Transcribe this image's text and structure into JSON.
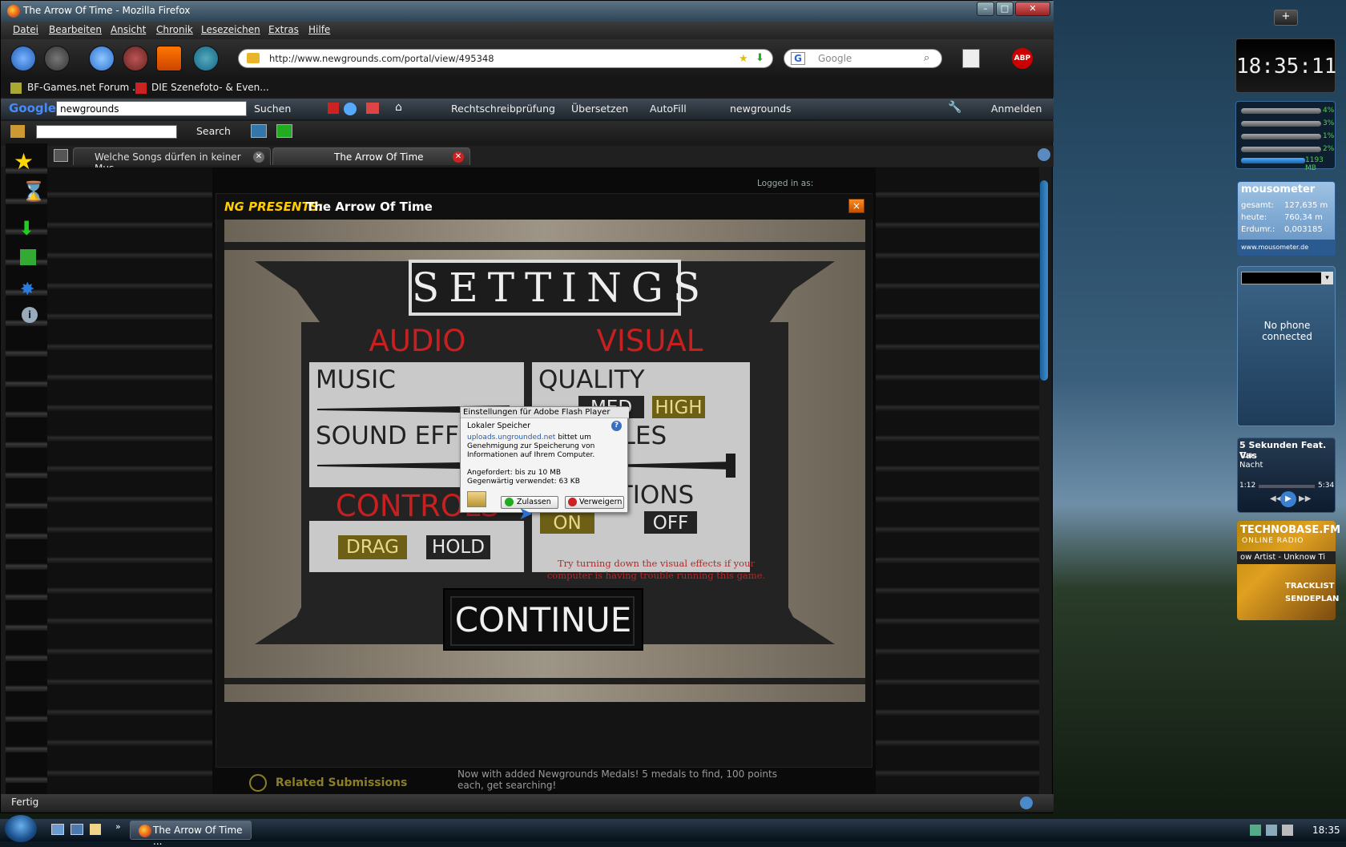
{
  "window": {
    "title": "The Arrow Of Time - Mozilla Firefox"
  },
  "menu": [
    "Datei",
    "Bearbeiten",
    "Ansicht",
    "Chronik",
    "Lesezeichen",
    "Extras",
    "Hilfe"
  ],
  "nav": {
    "url": "http://www.newgrounds.com/portal/view/495348",
    "search_placeholder": "Google"
  },
  "bookmarks": [
    "BF-Games.net Forum ...",
    "DIE Szenefoto- & Even..."
  ],
  "google_toolbar": {
    "query": "newgrounds",
    "items": [
      "Suchen",
      "Rechtschreibprüfung",
      "Übersetzen",
      "AutoFill",
      "newgrounds",
      "Anmelden"
    ]
  },
  "toolbar3": {
    "search_label": "Search"
  },
  "tabs": [
    {
      "label": "Welche Songs dürfen in keiner Mus..."
    },
    {
      "label": "The Arrow Of Time"
    }
  ],
  "status": "Fertig",
  "page": {
    "logged_in": "Logged in as:",
    "related": "Related Submissions",
    "related_text": "Now with added Newgrounds Medals! 5 medals to find, 100 points each, get searching!"
  },
  "modal": {
    "prefix": "NG PRESENTS:",
    "title": "The Arrow Of Time",
    "close": "×"
  },
  "game": {
    "settings_title": "SETTINGS",
    "audio": {
      "heading": "AUDIO",
      "music": "MUSIC",
      "sound": "SOUND EFF"
    },
    "visual": {
      "heading": "VISUAL",
      "quality": "QUALITY",
      "med": "MED",
      "high": "HIGH",
      "particles": "CLES",
      "animations": "ATIONS",
      "on": "ON",
      "off": "OFF"
    },
    "controls": {
      "heading": "CONTROLS",
      "drag": "DRAG",
      "hold": "HOLD"
    },
    "hint": "Try turning down the visual effects if your computer is having trouble running this game.",
    "continue": "CONTINUE"
  },
  "flash_dialog": {
    "title": "Einstellungen für Adobe Flash Player",
    "subtitle": "Lokaler Speicher",
    "link": "uploads.ungrounded.net",
    "body": "bittet um Genehmigung zur Speicherung von Informationen auf Ihrem Computer.",
    "requested": "Angefordert: bis zu 10 MB",
    "current": "Gegenwärtig verwendet: 63 KB",
    "allow": "Zulassen",
    "deny": "Verweigern",
    "help": "?"
  },
  "taskbar": {
    "item": "The Arrow Of Time ...",
    "time": "18:35"
  },
  "gadgets": {
    "clock": "18:35:11",
    "cpu": [
      "4%",
      "3%",
      "1%",
      "2%"
    ],
    "memory": "1193 MB",
    "mousometer": {
      "title": "mousometer",
      "rows": [
        {
          "label": "gesamt:",
          "value": "127,635 m"
        },
        {
          "label": "heute:",
          "value": "760,34 m"
        },
        {
          "label": "Erdumr.:",
          "value": "0,003185"
        }
      ],
      "url": "www.mousometer.de"
    },
    "phone": "No phone connected",
    "media": {
      "title": "5 Sekunden Feat. Vas",
      "artist": "Tua",
      "album": "Nacht",
      "elapsed": "1:12",
      "total": "5:34"
    },
    "radio": {
      "name": "TECHNOBASE.FM",
      "sub": "ONLINE RADIO",
      "ticker": "ow Artist - Unknow Ti",
      "btn1": "TRACKLIST",
      "btn2": "SENDEPLAN"
    }
  }
}
